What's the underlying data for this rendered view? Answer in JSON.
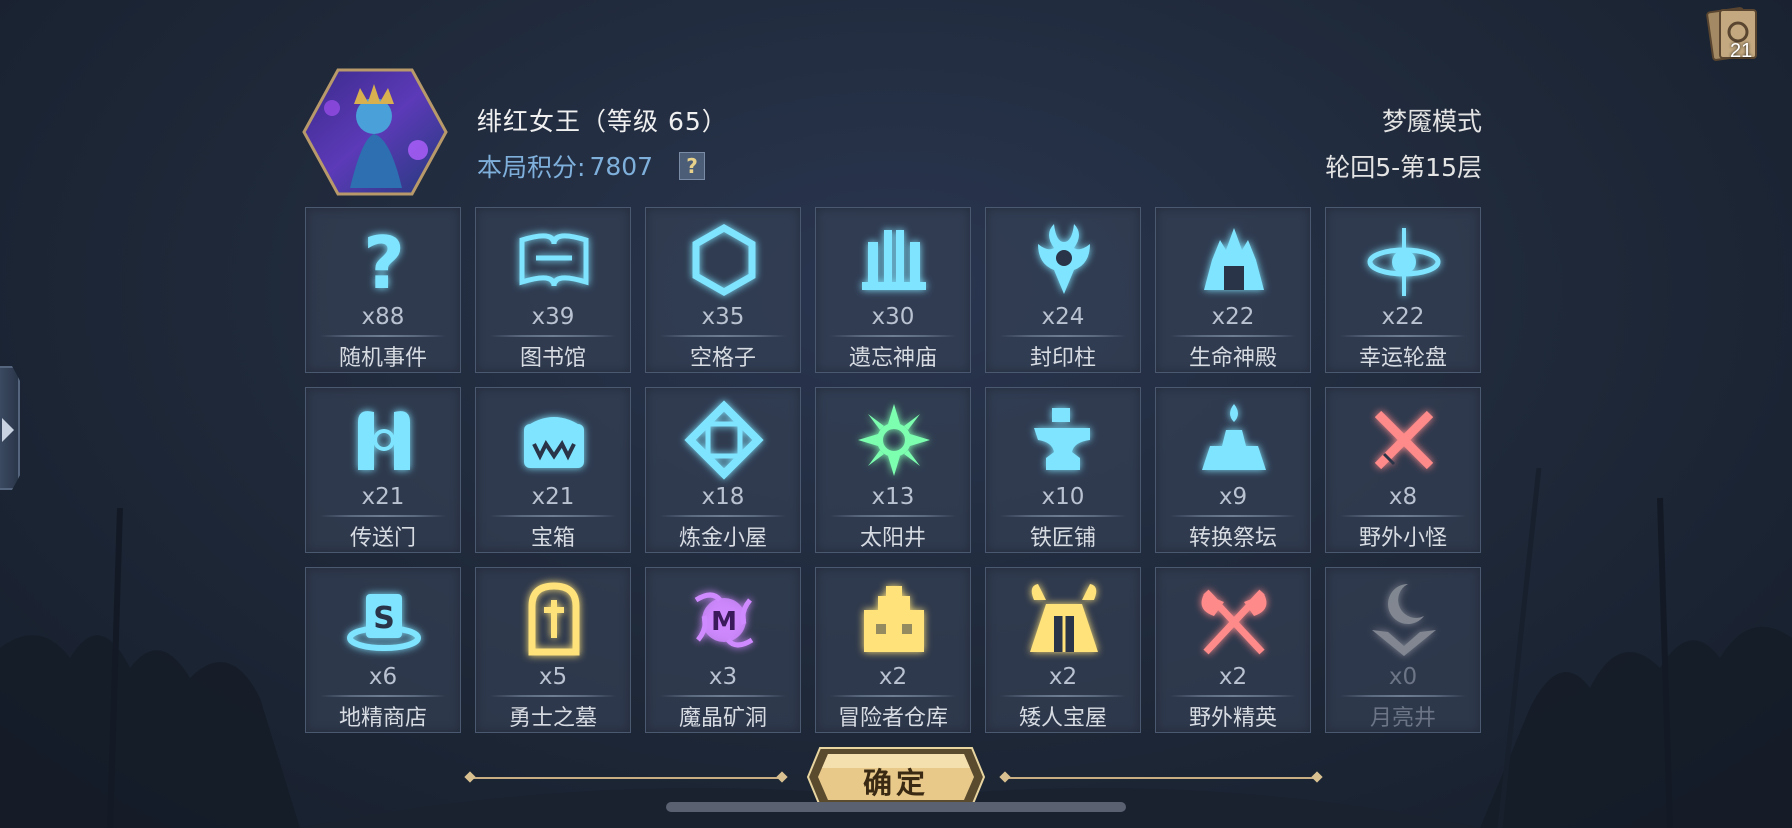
{
  "header": {
    "hero_name": "绯红女王（等级 65）",
    "score_label": "本局积分:",
    "score_value": "7807",
    "help_label": "?",
    "mode": "梦魇模式",
    "round": "轮回5-第15层"
  },
  "deck": {
    "count": "21",
    "icon": "card-deck-icon"
  },
  "events": [
    {
      "count": "x88",
      "name": "随机事件",
      "icon": "question-icon",
      "color": "#7fe4ff"
    },
    {
      "count": "x39",
      "name": "图书馆",
      "icon": "open-book-icon",
      "color": "#7fe4ff"
    },
    {
      "count": "x35",
      "name": "空格子",
      "icon": "hexagon-icon",
      "color": "#7fe4ff"
    },
    {
      "count": "x30",
      "name": "遗忘神庙",
      "icon": "temple-icon",
      "color": "#7fe4ff"
    },
    {
      "count": "x24",
      "name": "封印柱",
      "icon": "seal-pillar-icon",
      "color": "#7fe4ff"
    },
    {
      "count": "x22",
      "name": "生命神殿",
      "icon": "life-shrine-icon",
      "color": "#7fe4ff"
    },
    {
      "count": "x22",
      "name": "幸运轮盘",
      "icon": "lucky-wheel-icon",
      "color": "#7fe4ff"
    },
    {
      "count": "x21",
      "name": "传送门",
      "icon": "portal-icon",
      "color": "#7fe4ff"
    },
    {
      "count": "x21",
      "name": "宝箱",
      "icon": "chest-icon",
      "color": "#7fe4ff"
    },
    {
      "count": "x18",
      "name": "炼金小屋",
      "icon": "alchemy-icon",
      "color": "#7fe4ff"
    },
    {
      "count": "x13",
      "name": "太阳井",
      "icon": "sun-well-icon",
      "color": "#7dffb0"
    },
    {
      "count": "x10",
      "name": "铁匠铺",
      "icon": "anvil-icon",
      "color": "#7fe4ff"
    },
    {
      "count": "x9",
      "name": "转换祭坛",
      "icon": "altar-icon",
      "color": "#7fe4ff"
    },
    {
      "count": "x8",
      "name": "野外小怪",
      "icon": "crossed-swords-icon",
      "color": "#ff8a8a"
    },
    {
      "count": "x6",
      "name": "地精商店",
      "icon": "goblin-shop-icon",
      "color": "#7fe4ff"
    },
    {
      "count": "x5",
      "name": "勇士之墓",
      "icon": "tomb-icon",
      "color": "#ffe27a"
    },
    {
      "count": "x3",
      "name": "魔晶矿洞",
      "icon": "magic-crystal-icon",
      "color": "#d08aff"
    },
    {
      "count": "x2",
      "name": "冒险者仓库",
      "icon": "warehouse-icon",
      "color": "#ffe27a"
    },
    {
      "count": "x2",
      "name": "矮人宝屋",
      "icon": "dwarf-house-icon",
      "color": "#ffe27a"
    },
    {
      "count": "x2",
      "name": "野外精英",
      "icon": "crossed-axes-icon",
      "color": "#ff8a8a"
    },
    {
      "count": "x0",
      "name": "月亮井",
      "icon": "moon-well-icon",
      "color": "#e6e6e6"
    }
  ],
  "confirm": {
    "label": "确定"
  }
}
